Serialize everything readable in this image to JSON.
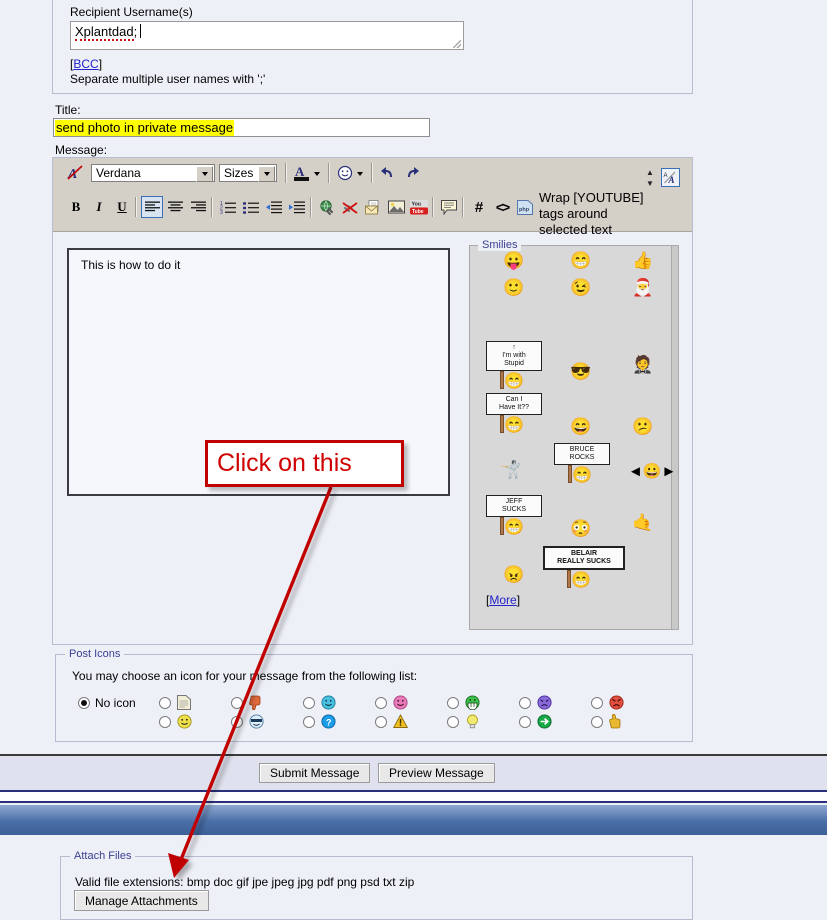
{
  "recipient": {
    "label": "Recipient Username(s)",
    "value": "Xplantdad",
    "separator": ";",
    "bcc_label": "BCC",
    "hint": "Separate multiple user names with ';'"
  },
  "title": {
    "label": "Title:",
    "value": "send photo in private message",
    "highlight_color": "#ffff00"
  },
  "message": {
    "label": "Message:",
    "body": "This is how to do it"
  },
  "toolbar": {
    "remove_format_icon": "remove-formatting-icon",
    "font_family": "Verdana",
    "font_size": "Sizes",
    "font_color_icon": "font-color-icon",
    "smilie_icon": "smilie-icon",
    "undo_icon": "undo-icon",
    "redo_icon": "redo-icon",
    "bold_label": "B",
    "italic_label": "I",
    "underline_label": "U",
    "align_left_icon": "align-left-icon",
    "align_center_icon": "align-center-icon",
    "align_right_icon": "align-right-icon",
    "ordered_list_icon": "ordered-list-icon",
    "unordered_list_icon": "unordered-list-icon",
    "outdent_icon": "outdent-icon",
    "indent_icon": "indent-icon",
    "link_icon": "insert-link-icon",
    "unlink_icon": "remove-link-icon",
    "email_icon": "insert-email-icon",
    "image_icon": "insert-image-icon",
    "youtube_icon": "youtube-icon",
    "quote_icon": "quote-icon",
    "hash_label": "#",
    "code_label": "<>",
    "php_label": "php",
    "wysiwyg_toggle_icon": "wysiwyg-toggle-icon",
    "size_stepper_icon": "size-stepper-icon",
    "tooltip": "Wrap [YOUTUBE] tags around selected text"
  },
  "smilies": {
    "legend": "Smilies",
    "more_label": "More",
    "items": [
      {
        "glyph": "😛",
        "name": "tongue-smiley"
      },
      {
        "glyph": "😁",
        "name": "green-grin-smiley"
      },
      {
        "glyph": "👍",
        "name": "thumbs-up-smiley"
      },
      {
        "glyph": "🙂",
        "name": "plain-smiley"
      },
      {
        "glyph": "😉",
        "name": "wink-smiley"
      },
      {
        "glyph": "🎅",
        "name": "santa-smiley"
      },
      {
        "glyph": "😎",
        "name": "cool-sunglasses-smiley"
      },
      {
        "glyph": "🤵",
        "name": "formal-smiley"
      },
      {
        "glyph": "😄",
        "name": "big-grin-smiley"
      },
      {
        "glyph": "😕",
        "name": "confused-smiley"
      },
      {
        "glyph": "🤺",
        "name": "fencing-smiley"
      },
      {
        "glyph": "😮",
        "name": "surprised-smiley"
      },
      {
        "glyph": "😳",
        "name": "shocked-smiley"
      },
      {
        "glyph": "🤙",
        "name": "drink-smiley"
      },
      {
        "glyph": "😠",
        "name": "angry-smiley"
      }
    ],
    "signs": [
      {
        "lines": [
          "↑",
          "I'm with",
          "Stupid"
        ],
        "name": "im-with-stupid-sign"
      },
      {
        "lines": [
          "Can I",
          "Have It??"
        ],
        "name": "can-i-have-it-sign"
      },
      {
        "lines": [
          "BRUCE",
          "ROCKS"
        ],
        "name": "bruce-rocks-sign"
      },
      {
        "lines": [
          "JEFF",
          "SUCKS"
        ],
        "name": "jeff-sucks-sign"
      },
      {
        "lines": [
          "BELAIR",
          "REALLY SUCKS"
        ],
        "name": "belair-really-sucks-sign"
      }
    ]
  },
  "post_icons": {
    "legend": "Post Icons",
    "description": "You may choose an icon for your message from the following list:",
    "no_icon_label": "No icon",
    "icons": [
      {
        "name": "post-icon-document",
        "glyph": "📄",
        "color": "#e8e4c8",
        "selected": false
      },
      {
        "name": "post-icon-smile",
        "glyph": "🙂",
        "color": "#f0e04a",
        "selected": false
      },
      {
        "name": "post-icon-thumbs-down",
        "glyph": "👎",
        "color": "#e06a3a",
        "selected": false
      },
      {
        "name": "post-icon-cool",
        "glyph": "😎",
        "color": "#5aa8e8",
        "selected": false
      },
      {
        "name": "post-icon-happy-blue",
        "glyph": "😃",
        "color": "#4ac0e0",
        "selected": false
      },
      {
        "name": "post-icon-question",
        "glyph": "?",
        "color": "#1a9ee8",
        "selected": false
      },
      {
        "name": "post-icon-pink-smile",
        "glyph": "😊",
        "color": "#e87ab8",
        "selected": false
      },
      {
        "name": "post-icon-warning",
        "glyph": "!",
        "color": "#f0c020",
        "selected": false
      },
      {
        "name": "post-icon-green-grin",
        "glyph": "😁",
        "color": "#3ec04a",
        "selected": false
      },
      {
        "name": "post-icon-lightbulb",
        "glyph": "💡",
        "color": "#f0eb70",
        "selected": false
      },
      {
        "name": "post-icon-purple-sad",
        "glyph": "😞",
        "color": "#8a6ad8",
        "selected": false
      },
      {
        "name": "post-icon-arrow",
        "glyph": "→",
        "color": "#18a848",
        "selected": false
      },
      {
        "name": "post-icon-red-angry",
        "glyph": "😡",
        "color": "#e05040",
        "selected": false
      },
      {
        "name": "post-icon-thumbs-up",
        "glyph": "👍",
        "color": "#e8b830",
        "selected": false
      }
    ]
  },
  "buttons": {
    "submit": "Submit Message",
    "preview": "Preview Message",
    "manage_attachments": "Manage Attachments"
  },
  "attach": {
    "legend": "Attach Files",
    "valid_extensions_text": "Valid file extensions: bmp doc gif jpe jpeg jpg pdf png psd txt zip"
  },
  "annotation": {
    "callout_text": "Click on this",
    "color": "#d00000"
  }
}
